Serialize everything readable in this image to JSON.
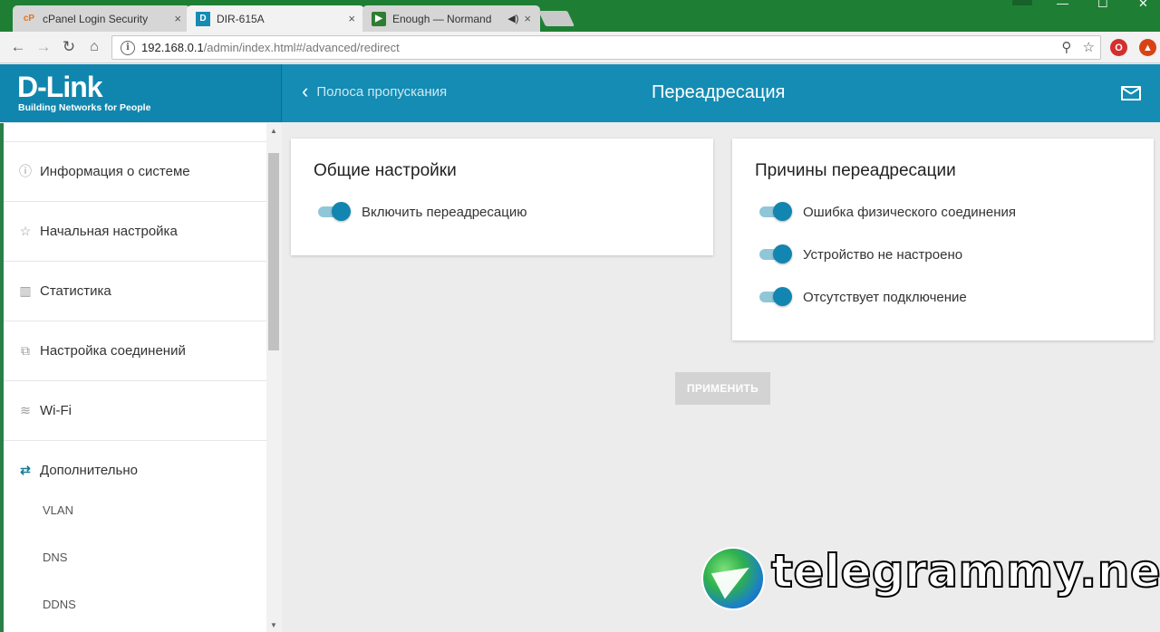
{
  "browser": {
    "tabs": [
      {
        "title": "cPanel Login Security",
        "icon": "cpanel-icon",
        "active": false
      },
      {
        "title": "DIR-615A",
        "icon": "dlink-icon",
        "active": true
      },
      {
        "title": "Enough — Normand",
        "icon": "play-icon",
        "active": false
      }
    ],
    "close_glyph": "×",
    "url_host": "192.168.0.1",
    "url_path": "/admin/index.html#/advanced/redirect"
  },
  "logo": {
    "main": "D-Link",
    "tagline": "Building Networks for People"
  },
  "header": {
    "back_label": "Полоса пропускания",
    "title": "Переадресация"
  },
  "sidebar": {
    "items": [
      {
        "label": "Информация о системе",
        "icon": "info-icon"
      },
      {
        "label": "Начальная настройка",
        "icon": "star-icon"
      },
      {
        "label": "Статистика",
        "icon": "chart-icon"
      },
      {
        "label": "Настройка соединений",
        "icon": "network-icon"
      },
      {
        "label": "Wi-Fi",
        "icon": "wifi-icon"
      },
      {
        "label": "Дополнительно",
        "icon": "swap-arrows-icon"
      }
    ],
    "subitems": [
      "VLAN",
      "DNS",
      "DDNS"
    ]
  },
  "general_card": {
    "title": "Общие настройки",
    "toggle_label": "Включить переадресацию",
    "toggle_on": true
  },
  "reasons_card": {
    "title": "Причины переадресации",
    "toggles": [
      {
        "label": "Ошибка физического соединения",
        "on": true
      },
      {
        "label": "Устройство не настроено",
        "on": true
      },
      {
        "label": "Отсутствует подключение",
        "on": true
      }
    ]
  },
  "apply_label": "ПРИМЕНИТЬ",
  "watermark": "telegrammy.net",
  "colors": {
    "accent": "#148cb4",
    "switch_on": "#1286b0",
    "tabstrip": "#1e7f34"
  }
}
